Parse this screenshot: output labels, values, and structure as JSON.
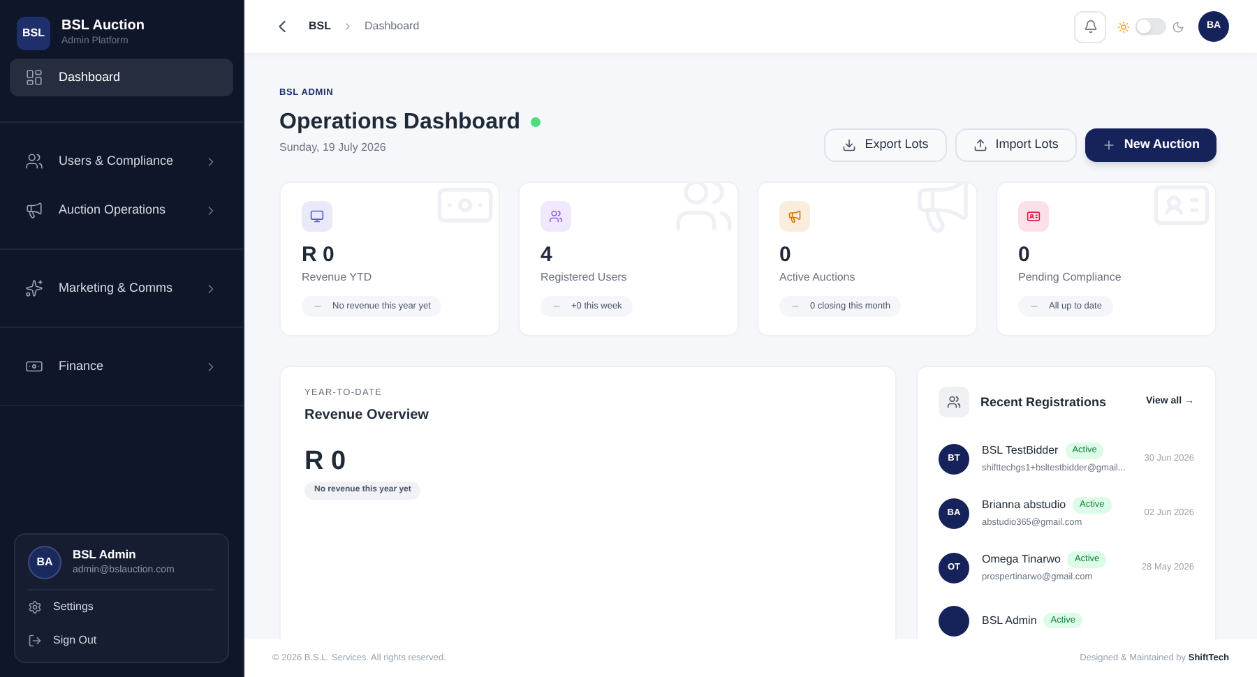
{
  "brand": {
    "logo": "BSL",
    "name": "BSL Auction",
    "subtitle": "Admin Platform"
  },
  "sidebar": {
    "sections": [
      [
        {
          "label": "Dashboard",
          "selected": true
        }
      ],
      [
        {
          "label": "Users & Compliance",
          "selected": false,
          "expanded": false
        },
        {
          "label": "Auction Operations",
          "selected": false,
          "expanded": false
        }
      ],
      [
        {
          "label": "Marketing & Comms",
          "selected": false,
          "expanded": false
        }
      ],
      [
        {
          "label": "Finance",
          "selected": false,
          "expanded": false
        }
      ]
    ]
  },
  "user_card": {
    "initials": "BA",
    "name": "BSL Admin",
    "email": "admin@bslauction.com",
    "menu": [
      "Settings",
      "Sign Out"
    ]
  },
  "header": {
    "breadcrumb": [
      "BSL",
      "Dashboard"
    ],
    "dark_mode": false,
    "initials": "BA"
  },
  "page": {
    "eyebrow": "BSL ADMIN",
    "title": "Operations Dashboard",
    "online": true,
    "date": "Sunday, 19 July 2026",
    "actions": [
      {
        "label": "Export Lots",
        "kind": "outline"
      },
      {
        "label": "Import Lots",
        "kind": "outline"
      },
      {
        "label": "New Auction",
        "kind": "primary"
      }
    ]
  },
  "stats": [
    {
      "value": "R 0",
      "label": "Revenue YTD",
      "note": "No revenue this year yet",
      "color": "#5b5bd6"
    },
    {
      "value": "4",
      "label": "Registered Users",
      "note": "+0 this week",
      "color": "#8b5cf6"
    },
    {
      "value": "0",
      "label": "Active Auctions",
      "note": "0 closing this month",
      "color": "#d97706"
    },
    {
      "value": "0",
      "label": "Pending Compliance",
      "note": "All up to date",
      "color": "#e11d48"
    }
  ],
  "revenue": {
    "eyebrow": "YEAR-TO-DATE",
    "title": "Revenue Overview",
    "value": "R 0",
    "note": "No revenue this year yet"
  },
  "registrations": {
    "title": "Recent Registrations",
    "link": "View all →",
    "items": [
      {
        "initials": "BT",
        "name": "BSL TestBidder",
        "status": "Active",
        "email": "shifttechgs1+bsltestbidder@gmail...",
        "date": "30 Jun 2026"
      },
      {
        "initials": "BA",
        "name": "Brianna abstudio",
        "status": "Active",
        "email": "abstudio365@gmail.com",
        "date": "02 Jun 2026"
      },
      {
        "initials": "OT",
        "name": "Omega Tinarwo",
        "status": "Active",
        "email": "prospertinarwo@gmail.com",
        "date": "28 May 2026"
      },
      {
        "name": "BSL Admin",
        "status": "Active"
      }
    ]
  },
  "footer": {
    "copyright": "© 2026 B.S.L. Services. All rights reserved.",
    "credit": "Designed & Maintained by **ShiftTech**"
  }
}
